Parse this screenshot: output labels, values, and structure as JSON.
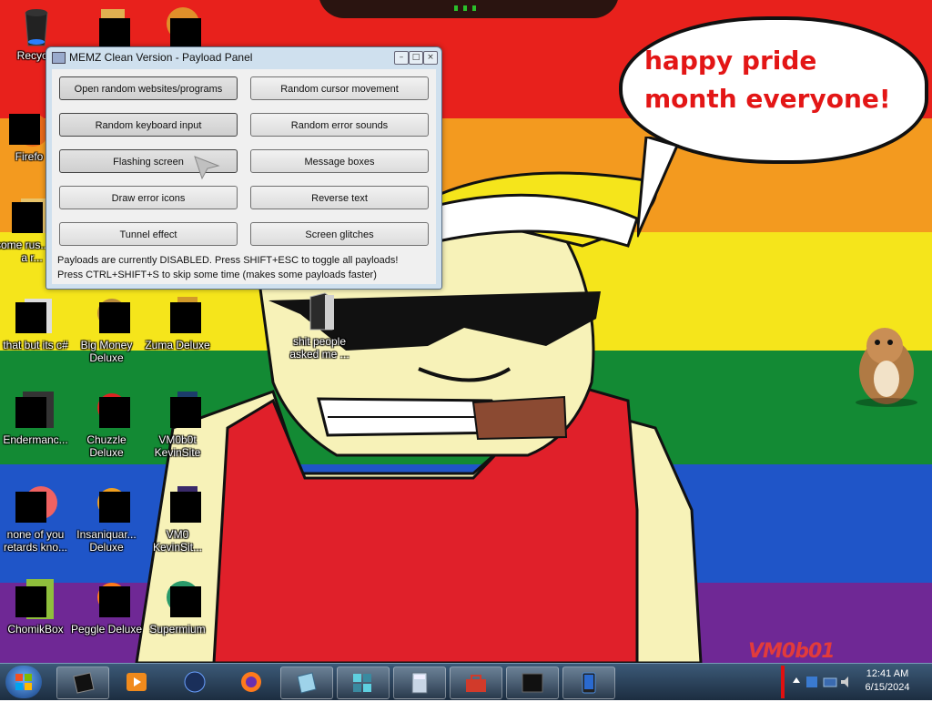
{
  "speech_bubble": {
    "text": "happy pride month everyone!"
  },
  "watermark": "VM0b01",
  "window": {
    "title": "MEMZ Clean Version - Payload Panel",
    "buttons": [
      "Open random websites/programs",
      "Random cursor movement",
      "Random keyboard input",
      "Random error sounds",
      "Flashing screen",
      "Message boxes",
      "Draw error icons",
      "Reverse text",
      "Tunnel effect",
      "Screen glitches"
    ],
    "status_line_1": "Payloads are currently DISABLED. Press SHIFT+ESC to toggle all payloads!",
    "status_line_2": "Press CTRL+SHIFT+S to skip some time (makes some payloads faster)"
  },
  "desktop_icons": [
    {
      "label": "Recycle",
      "icon": "recycle-bin-icon"
    },
    {
      "label": "Firefo",
      "icon": "firefox-icon"
    },
    {
      "label": "some rus... ran a r...",
      "icon": "file-icon"
    },
    {
      "label": "that but its c#",
      "icon": "file-icon"
    },
    {
      "label": "Endermanc...",
      "icon": "app-icon"
    },
    {
      "label": "none of you retards kno...",
      "icon": "app-icon"
    },
    {
      "label": "ChomikBox",
      "icon": "chomikbox-icon"
    },
    {
      "label": "Big Money Deluxe",
      "icon": "game-icon"
    },
    {
      "label": "Chuzzle Deluxe",
      "icon": "game-icon"
    },
    {
      "label": "Insaniquar... Deluxe",
      "icon": "game-icon"
    },
    {
      "label": "Peggle Deluxe",
      "icon": "game-icon"
    },
    {
      "label": "Zuma Deluxe",
      "icon": "game-icon"
    },
    {
      "label": "VM0b0t KevinSite",
      "icon": "app-icon"
    },
    {
      "label": "VM0 KevinSit...",
      "icon": "app-icon"
    },
    {
      "label": "Supermium",
      "icon": "browser-icon"
    },
    {
      "label": "shit people asked me ...",
      "icon": "folder-icon"
    }
  ],
  "taskbar": {
    "items": [
      "cmd-icon",
      "media-player-icon",
      "globe-icon",
      "firefox-icon",
      "notepad-icon",
      "puzzle-icon",
      "calculator-icon",
      "toolbox-icon",
      "terminal-icon",
      "tablet-icon"
    ],
    "time": "12:41 AM",
    "date": "6/15/2024"
  },
  "colors": {
    "red": "#e8211c",
    "orange": "#f39a1f",
    "yellow": "#f5e51b",
    "green": "#138a34",
    "blue": "#1f55c8",
    "purple": "#6f2895",
    "bubble_text": "#e31616"
  }
}
